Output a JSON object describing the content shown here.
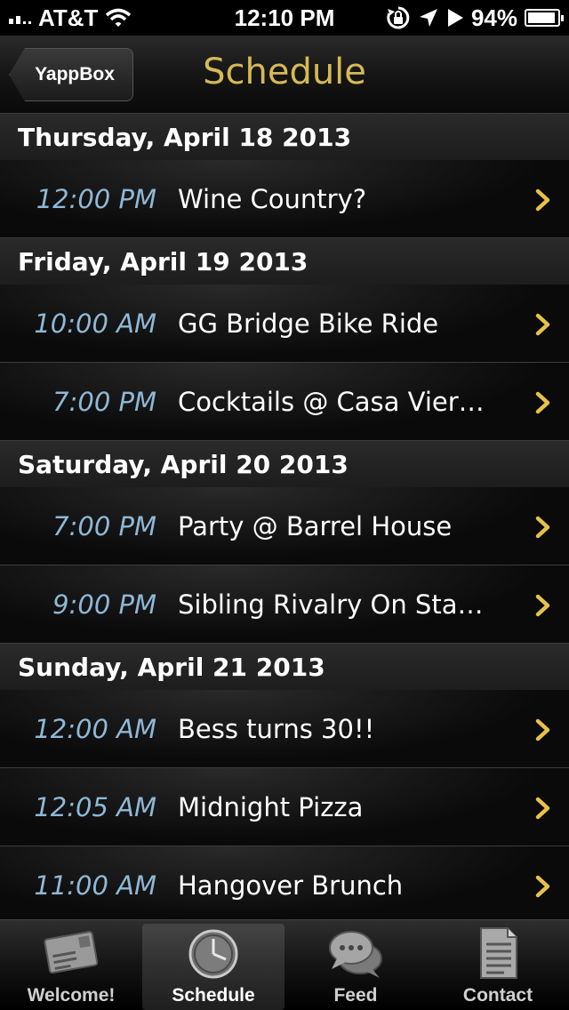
{
  "status_bar": {
    "carrier": "AT&T",
    "time": "12:10 PM",
    "battery": "94%",
    "battery_level": 0.94,
    "icons": [
      "signal-icon",
      "wifi-icon",
      "rotation-lock-icon",
      "location-icon",
      "play-icon",
      "battery-icon"
    ]
  },
  "nav": {
    "back_label": "YappBox",
    "title": "Schedule",
    "title_color": "#d6b955"
  },
  "sections": [
    {
      "header": "Thursday, April 18 2013",
      "events": [
        {
          "time": "12:00 PM",
          "title": "Wine Country?"
        }
      ]
    },
    {
      "header": "Friday, April 19 2013",
      "events": [
        {
          "time": "10:00 AM",
          "title": "GG Bridge Bike Ride"
        },
        {
          "time": "7:00 PM",
          "title": "Cocktails @ Casa Vier…"
        }
      ]
    },
    {
      "header": "Saturday, April 20 2013",
      "events": [
        {
          "time": "7:00 PM",
          "title": "Party @ Barrel House"
        },
        {
          "time": "9:00 PM",
          "title": "Sibling Rivalry On Stage"
        }
      ]
    },
    {
      "header": "Sunday, April 21 2013",
      "events": [
        {
          "time": "12:00 AM",
          "title": "Bess turns 30!!"
        },
        {
          "time": "12:05 AM",
          "title": "Midnight Pizza"
        },
        {
          "time": "11:00 AM",
          "title": "Hangover Brunch"
        }
      ]
    }
  ],
  "colors": {
    "time": "#8eb8d6",
    "chevron": "#e6c24a",
    "accent": "#d6b955"
  },
  "tabs": [
    {
      "label": "Welcome!",
      "icon": "postcard-icon",
      "active": false
    },
    {
      "label": "Schedule",
      "icon": "clock-icon",
      "active": true
    },
    {
      "label": "Feed",
      "icon": "chat-bubbles-icon",
      "active": false
    },
    {
      "label": "Contact",
      "icon": "document-icon",
      "active": false
    }
  ]
}
